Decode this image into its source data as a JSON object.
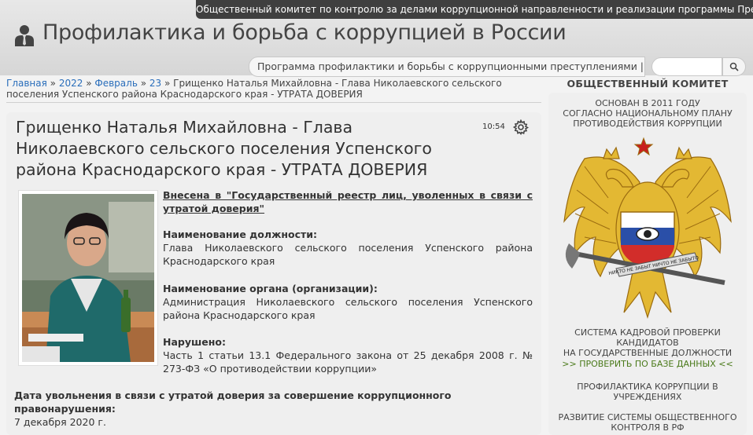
{
  "header": {
    "ribbon_text": "Общественный комитет по контролю за делами коррупционной направленности и реализации программы Президента РФ",
    "site_title": "Профилактика и борьба с коррупцией в России",
    "subnav_text": "Программа профилактики и борьбы с коррупционными преступлениями | Поиск в БД:",
    "search_placeholder": ""
  },
  "breadcrumb": {
    "home": "Главная",
    "sep": "»",
    "year": "2022",
    "month": "Февраль",
    "day": "23",
    "current": "Грищенко Наталья Михайловна - Глава Николаевского сельского поселения Успенского района Краснодарского края - УТРАТА ДОВЕРИЯ"
  },
  "article": {
    "title": "Грищенко Наталья Михайловна - Глава Николаевского сельского поселения Успенского района Краснодарского края - УТРАТА ДОВЕРИЯ",
    "time": "10:54",
    "registry_link": "Внесена в \"Государственный реестр лиц, уволенных в связи с утратой доверия\"",
    "position_label": "Наименование должности:",
    "position_value": "Глава Николаевского сельского поселения Успенского района Краснодарского края",
    "org_label": "Наименование органа (организации):",
    "org_value": "Администрация Николаевского сельского поселения Успенского района Краснодарского края",
    "violation_label": "Нарушено:",
    "violation_value": "Часть 1 статьи 13.1 Федерального закона от 25 декабря 2008 г. № 273-ФЗ «О противодействии коррупции»",
    "dismissal_label": "Дата увольнения в связи с утратой доверия за совершение коррупционного правонарушения:",
    "dismissal_value": "7 декабря 2020 г."
  },
  "sidebar": {
    "heading": "ОБЩЕСТВЕННЫЙ КОМИТЕТ",
    "founded_line1": "Основан в 2011 году",
    "founded_line2": "согласно национальному плану",
    "founded_line3": "противодействия коррупции",
    "emblem_motto": "НИКТО НЕ ЗАБЫТ НИЧТО НЕ ЗАБЫТО",
    "system_line1": "Система кадровой проверки",
    "system_line2": "кандидатов",
    "system_line3": "на государственные должности",
    "check_link": ">> Проверить по базе данных <<",
    "prof_line1": "Профилактика коррупции в",
    "prof_line2": "учреждениях",
    "public_line1": "Развитие системы общественного",
    "public_line2": "контроля в РФ"
  },
  "colors": {
    "link": "#2a6ebb",
    "check_link": "#4a7a1a",
    "ribbon": "#3f3f3f"
  }
}
